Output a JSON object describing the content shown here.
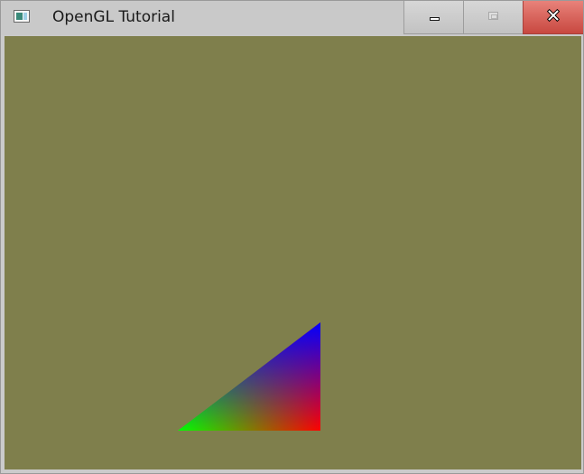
{
  "window": {
    "title": "OpenGL Tutorial",
    "app_icon": "window-app-icon",
    "controls": {
      "minimize_icon": "minimize-icon",
      "maximize_icon": "maximize-icon",
      "close_icon": "close-icon",
      "close_color": "#e35b52"
    }
  },
  "canvas": {
    "clear_color": "#7f7f4c",
    "triangle": {
      "vertex_colors": [
        "#00ff00",
        "#ff0000",
        "#0000ff"
      ]
    }
  }
}
